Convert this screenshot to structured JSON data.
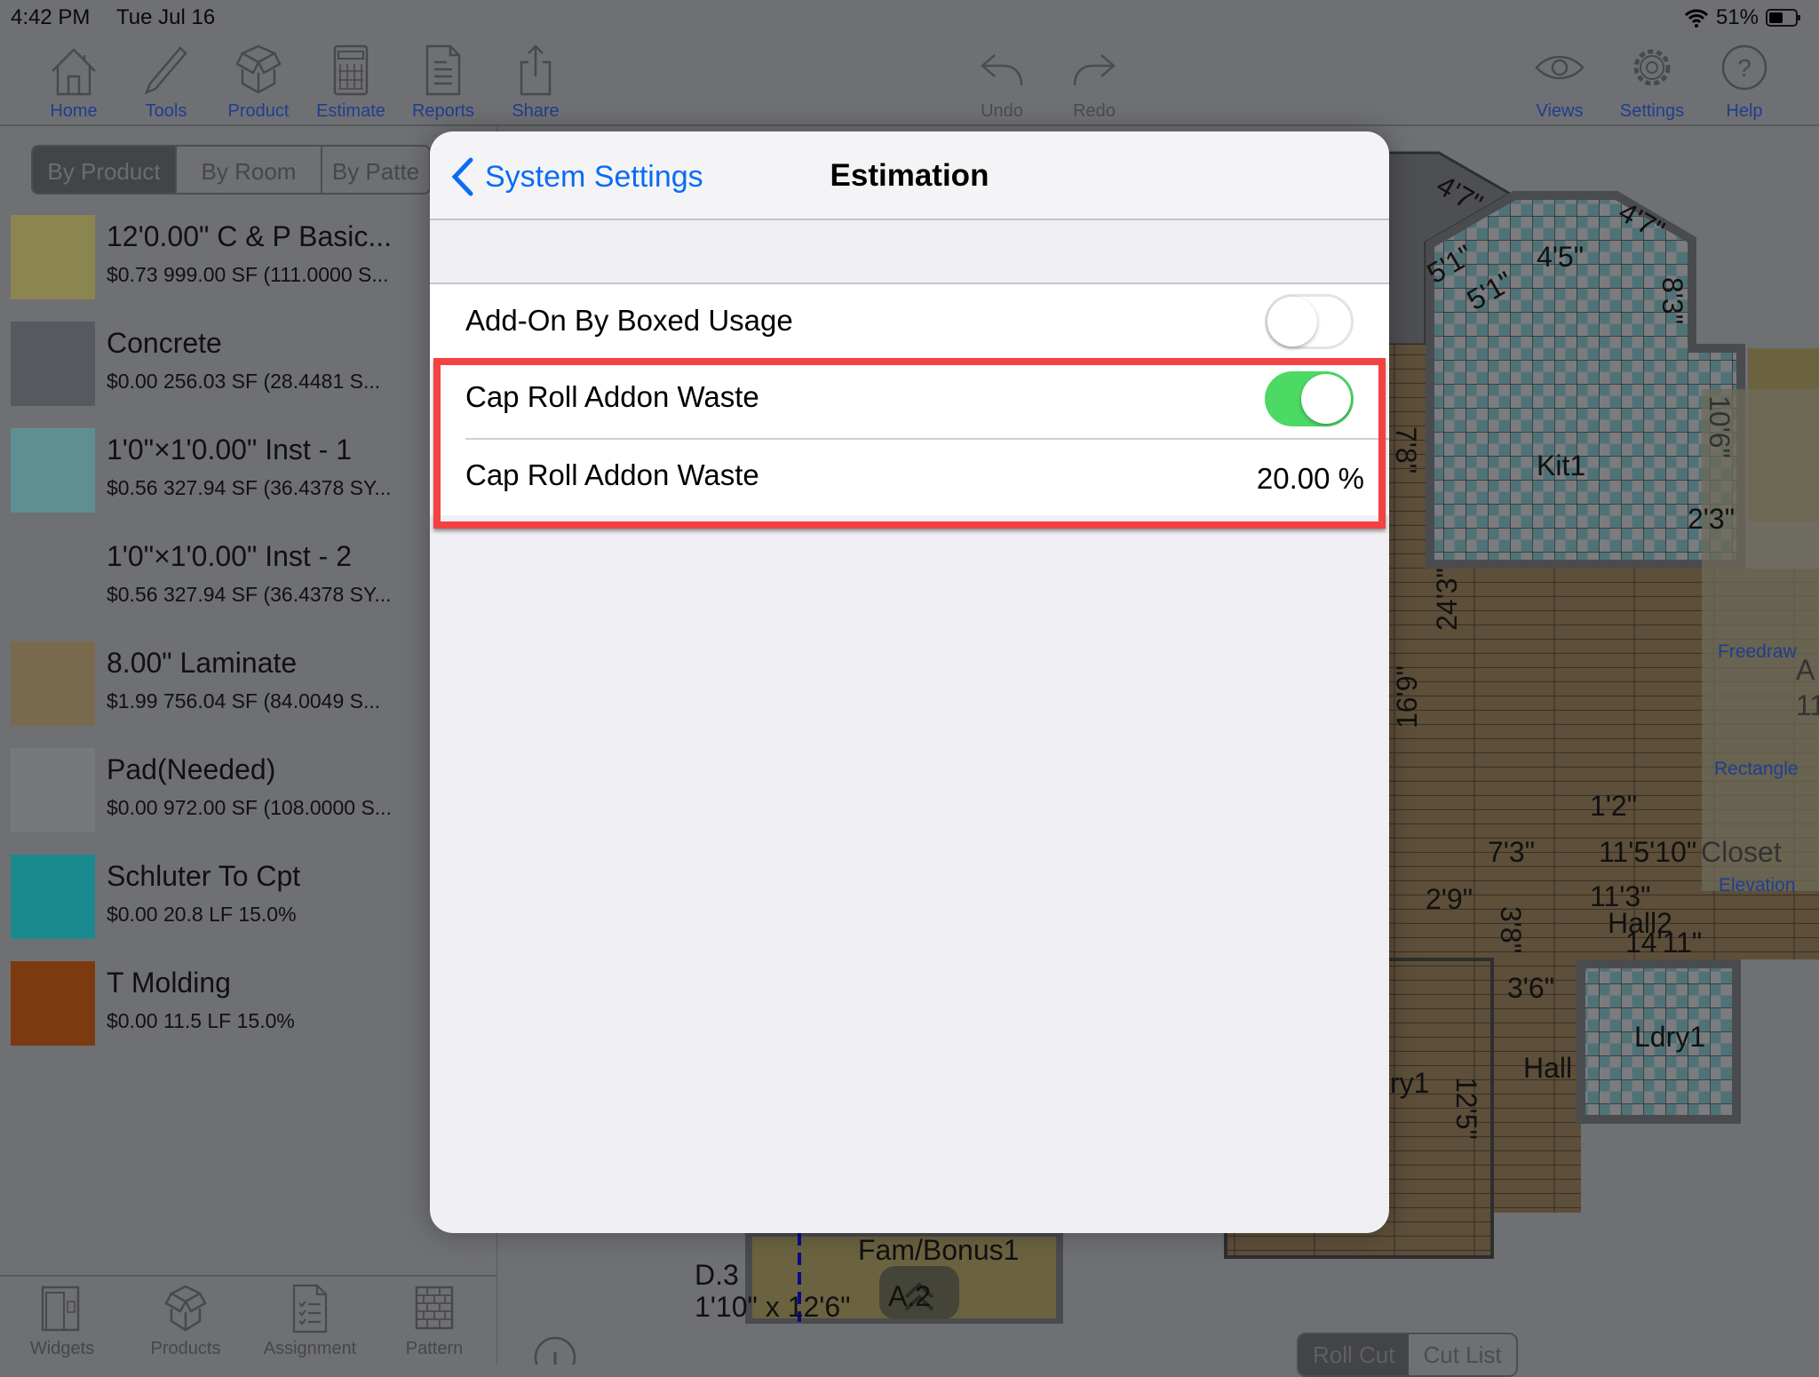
{
  "status": {
    "time": "4:42 PM",
    "date": "Tue Jul 16",
    "battery": "51%",
    "battery_level": 0.51
  },
  "toolbar": {
    "left": [
      {
        "label": "Home",
        "icon": "home-icon"
      },
      {
        "label": "Tools",
        "icon": "pencil-icon"
      },
      {
        "label": "Product",
        "icon": "box-icon"
      },
      {
        "label": "Estimate",
        "icon": "calculator-icon"
      },
      {
        "label": "Reports",
        "icon": "document-icon"
      },
      {
        "label": "Share",
        "icon": "share-icon"
      }
    ],
    "center": [
      {
        "label": "Undo",
        "icon": "undo-icon"
      },
      {
        "label": "Redo",
        "icon": "redo-icon"
      }
    ],
    "right": [
      {
        "label": "Views",
        "icon": "eye-icon"
      },
      {
        "label": "Settings",
        "icon": "gear-icon"
      },
      {
        "label": "Help",
        "icon": "help-icon"
      }
    ]
  },
  "left_panel": {
    "tabs": [
      "By Product",
      "By Room",
      "By Patte"
    ],
    "selected_tab": "By Product",
    "products": [
      {
        "title": "12'0.00\" C & P Basic...",
        "sub": "$0.73 999.00 SF (111.0000 S...",
        "color": "#8b8550"
      },
      {
        "title": "Concrete",
        "sub": "$0.00 256.03 SF (28.4481 S...",
        "color": "#58595e"
      },
      {
        "title": "1'0\"×1'0.00\" Inst -  1",
        "sub": "$0.56 327.94 SF (36.4378 SY...",
        "color": "#5f8f93"
      },
      {
        "title": "1'0\"×1'0.00\" Inst -  2",
        "sub": "$0.56 327.94 SF (36.4378 SY...",
        "color": ""
      },
      {
        "title": "8.00\" Laminate",
        "sub": "$1.99 756.04 SF (84.0049 S...",
        "color": "#7a6a4d"
      },
      {
        "title": "Pad(Needed)",
        "sub": "$0.00 972.00 SF (108.0000 S...",
        "color": "#77787c"
      },
      {
        "title": "Schluter To Cpt",
        "sub": "$0.00 20.8 LF 15.0%",
        "color": "#1b8a8e"
      },
      {
        "title": "T Molding",
        "sub": "$0.00 11.5 LF 15.0%",
        "color": "#7b3a0f"
      }
    ],
    "bottom_tabs": [
      {
        "label": "Widgets",
        "icon": "widgets-icon"
      },
      {
        "label": "Products",
        "icon": "box-icon"
      },
      {
        "label": "Assignment",
        "icon": "checklist-icon"
      },
      {
        "label": "Pattern",
        "icon": "pattern-icon"
      }
    ]
  },
  "modal": {
    "back_label": "System Settings",
    "title": "Estimation",
    "rows": [
      {
        "label": "Add-On By Boxed Usage",
        "toggle": false
      },
      {
        "label": "Cap Roll Addon Waste",
        "toggle": true
      },
      {
        "label": "Cap Roll Addon Waste",
        "value": "20.00 %"
      }
    ],
    "highlight_color": "#f44141",
    "toggle_on_color": "#4cd964"
  },
  "floorplan": {
    "labels": {
      "d1": "4'7\"",
      "d2": "5'1\"",
      "d3": "5'1\"",
      "d4": "4'5\"",
      "d5": "4'7\"",
      "d6": "7'8\"",
      "d7": "8'3\"",
      "kit": "Kit1",
      "d8": "2'3\"",
      "d9": "24'3\"",
      "d10": "16'9\"",
      "d11": "10'6\"",
      "d12": "7'3\"",
      "d13": "11'3\"",
      "hall2": "Hall2",
      "d14": "14'11\"",
      "d15": "3'6\"",
      "ldry": "Ldry1",
      "hall": "Hall",
      "d16": "12'5\"",
      "ry": "ry1",
      "a": "A",
      "a11": "11",
      "closet": "Closet",
      "fam": "Fam/Bonus1",
      "d3room": "D.3",
      "dsize": "1'10\" x 12'6\"",
      "a2": "A.2",
      "d17": "2'9\"",
      "d18": "3'8\"",
      "d19": "1'2\"",
      "d20": "11'5'10\""
    },
    "tools": [
      "Freedraw",
      "Rectangle",
      "Elevation"
    ]
  },
  "bottom_right": {
    "tabs": [
      "Roll Cut",
      "Cut List"
    ],
    "selected": "Roll Cut"
  }
}
